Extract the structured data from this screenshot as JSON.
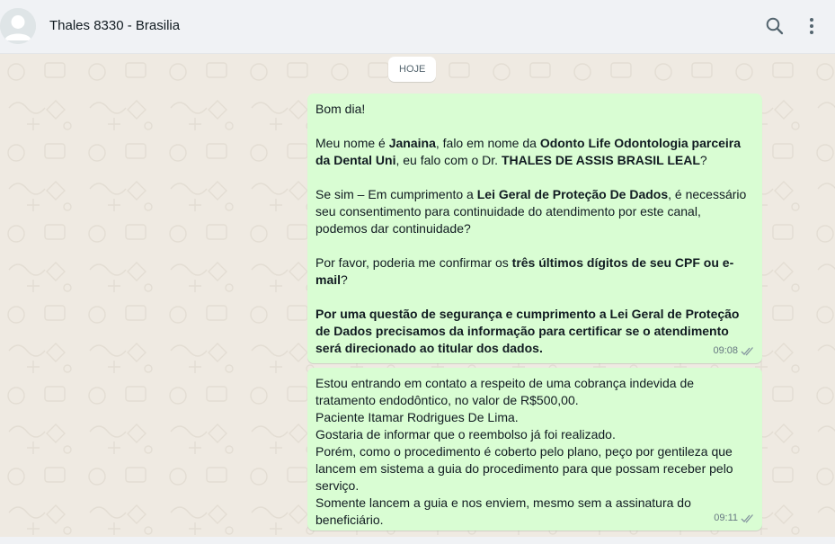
{
  "header": {
    "contact_name": "Thales 8330 - Brasilia"
  },
  "chat": {
    "day_label": "HOJE",
    "messages": [
      {
        "time": "09:08",
        "greeting": "Bom dia!",
        "p2_a": "Meu nome é ",
        "p2_name": "Janaina",
        "p2_b": ", falo em nome da ",
        "p2_company": "Odonto Life Odontologia parceira da Dental Uni",
        "p2_c": ", eu falo com o Dr. ",
        "p2_doctor": "THALES DE ASSIS BRASIL LEAL",
        "p2_d": "?",
        "p3_a": "Se sim – Em cumprimento a ",
        "p3_law": "Lei Geral de Proteção De Dados",
        "p3_b": ", é necessário seu consentimento para continuidade do atendimento por este canal, podemos dar continuidade?",
        "p4_a": "Por favor, poderia me confirmar os ",
        "p4_bold": "três últimos dígitos de seu CPF ou e-mail",
        "p4_b": "?",
        "p5_bold": "Por uma questão de segurança e cumprimento a Lei Geral de Proteção de Dados precisamos da informação para certificar se o atendimento será direcionado ao titular dos dados."
      },
      {
        "time": "09:11",
        "line1": "Estou entrando em contato a respeito de uma cobrança indevida de tratamento endodôntico, no valor de R$500,00.",
        "line2": "Paciente Itamar Rodrigues De Lima.",
        "line3": "Gostaria de informar que o reembolso já foi realizado.",
        "line4": "Porém, como o procedimento é coberto pelo plano, peço por gentileza que lancem em sistema a guia do procedimento para que possam receber pelo serviço.",
        "line5": "Somente lancem a guia e nos enviem, mesmo sem a assinatura do beneficiário."
      }
    ]
  },
  "colors": {
    "header_bg": "#f0f2f5",
    "chat_bg": "#efeae2",
    "outgoing_bubble": "#d9fdd3",
    "tick": "#8696a0"
  }
}
